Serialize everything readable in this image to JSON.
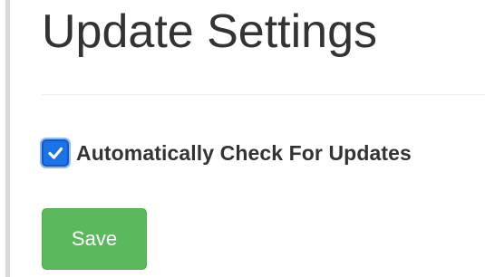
{
  "header": {
    "title": "Update Settings"
  },
  "settings": {
    "auto_check_label": "Automatically Check For Updates",
    "auto_check_checked": true
  },
  "actions": {
    "save_label": "Save"
  },
  "colors": {
    "title_text": "#333333",
    "checkbox_accent": "#1a73e8",
    "save_button_bg": "#5cb85c",
    "save_button_text": "#ffffff"
  },
  "icons": {
    "checkbox_mark": "checkmark-icon"
  }
}
